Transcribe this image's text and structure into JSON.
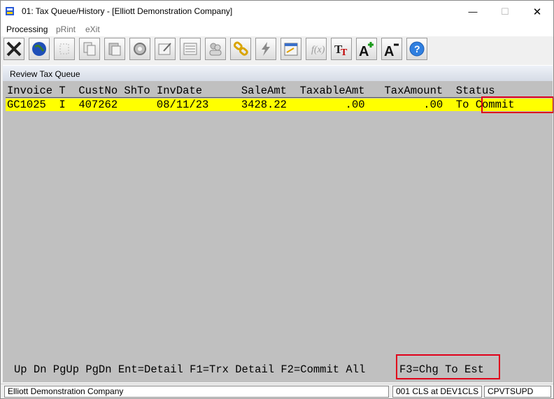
{
  "window": {
    "title": "01: Tax Queue/History - [Elliott Demonstration Company]"
  },
  "menu": [
    "Processing",
    "pRint",
    "eXit"
  ],
  "toolbar": [
    {
      "icon": "exit-icon"
    },
    {
      "icon": "globe-icon"
    },
    {
      "icon": "blank-icon"
    },
    {
      "icon": "copy-icon"
    },
    {
      "icon": "paste-icon"
    },
    {
      "icon": "settings-icon"
    },
    {
      "icon": "edit-icon"
    },
    {
      "icon": "list-icon"
    },
    {
      "icon": "users-icon"
    },
    {
      "icon": "link-icon"
    },
    {
      "icon": "lightning-icon"
    },
    {
      "icon": "calendar-icon"
    },
    {
      "icon": "function-icon"
    },
    {
      "icon": "font-icon"
    },
    {
      "icon": "font-increase-icon"
    },
    {
      "icon": "font-decrease-icon"
    },
    {
      "icon": "help-icon"
    }
  ],
  "panel": {
    "title": "Review Tax Queue"
  },
  "table": {
    "header": "Invoice T  CustNo ShTo InvDate      SaleAmt  TaxableAmt   TaxAmount  Status",
    "rows": [
      "GC1025  I  407262      08/11/23     3428.22         .00         .00  To Commit"
    ]
  },
  "function_keys": {
    "main": "Up Dn PgUp PgDn Ent=Detail F1=Trx Detail F2=Commit All",
    "f3": "F3=Chg To Est"
  },
  "statusbar": {
    "company": "Elliott Demonstration Company",
    "location": "001 CLS at DEV1CLS",
    "program": "CPVTSUPD"
  },
  "colors": {
    "highlight_row": "#ffff00",
    "annotation_box": "#e0001b",
    "grid_bg": "#c0c0c0"
  }
}
